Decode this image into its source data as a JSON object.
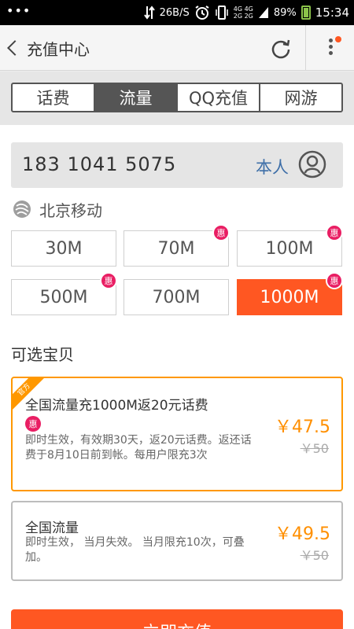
{
  "statusbar": {
    "dots": "•••",
    "speed": "26B/S",
    "net_top": "4G 4G",
    "net_bottom": "2G 2G",
    "battery": "89%",
    "time": "15:34"
  },
  "header": {
    "back_label": "充值中心"
  },
  "tabs": [
    {
      "label": "话费",
      "active": false
    },
    {
      "label": "流量",
      "active": true
    },
    {
      "label": "QQ充值",
      "active": false
    },
    {
      "label": "网游",
      "active": false
    }
  ],
  "phone": {
    "number": "183 1041 5075",
    "self_label": "本人"
  },
  "carrier": {
    "name": "北京移动"
  },
  "plans": [
    {
      "label": "30M",
      "hui": false,
      "selected": false
    },
    {
      "label": "70M",
      "hui": true,
      "selected": false
    },
    {
      "label": "100M",
      "hui": true,
      "selected": false
    },
    {
      "label": "500M",
      "hui": true,
      "selected": false
    },
    {
      "label": "700M",
      "hui": false,
      "selected": false
    },
    {
      "label": "1000M",
      "hui": true,
      "selected": true
    }
  ],
  "hui_label": "惠",
  "section_title": "可选宝贝",
  "products": [
    {
      "ribbon": "官方",
      "title": "全国流量充1000M返20元话费",
      "tag": "惠",
      "desc": "即时生效，有效期30天，返20元话费。返还话费于8月10日前到帐。每用户限充3次",
      "price": "￥47.5",
      "orig": "￥50"
    },
    {
      "title": "全国流量",
      "desc": "即时生效， 当月失效。 当月限充10次，可叠加。",
      "price": "￥49.5",
      "orig": "￥50"
    }
  ],
  "submit_label": "立即充值",
  "colors": {
    "accent": "#ff5722",
    "price": "#ff8f00",
    "hui": "#e91e63",
    "link": "#3e6fa8"
  }
}
